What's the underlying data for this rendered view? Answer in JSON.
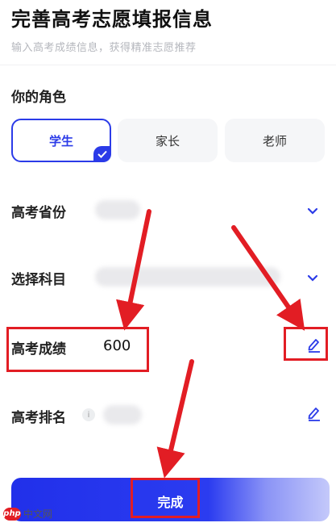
{
  "header": {
    "title": "完善高考志愿填报信息",
    "subtitle": "输入高考成绩信息，获得精准志愿推荐"
  },
  "role_section": {
    "label": "你的角色",
    "options": [
      {
        "label": "学生",
        "selected": true
      },
      {
        "label": "家长",
        "selected": false
      },
      {
        "label": "老师",
        "selected": false
      }
    ]
  },
  "fields": {
    "province": {
      "label": "高考省份",
      "value": "",
      "icon": "chevron-down-icon"
    },
    "subjects": {
      "label": "选择科目",
      "value": "",
      "icon": "chevron-down-icon"
    },
    "score": {
      "label": "高考成绩",
      "value": "600",
      "icon": "edit-pencil-icon"
    },
    "rank": {
      "label": "高考排名",
      "info": "i",
      "value": "",
      "icon": "edit-pencil-icon"
    }
  },
  "submit": {
    "label": "完成"
  },
  "watermark": {
    "logo": "php",
    "text": "中文网"
  },
  "colors": {
    "accent": "#2b3be8",
    "annotation": "#e21d24"
  }
}
